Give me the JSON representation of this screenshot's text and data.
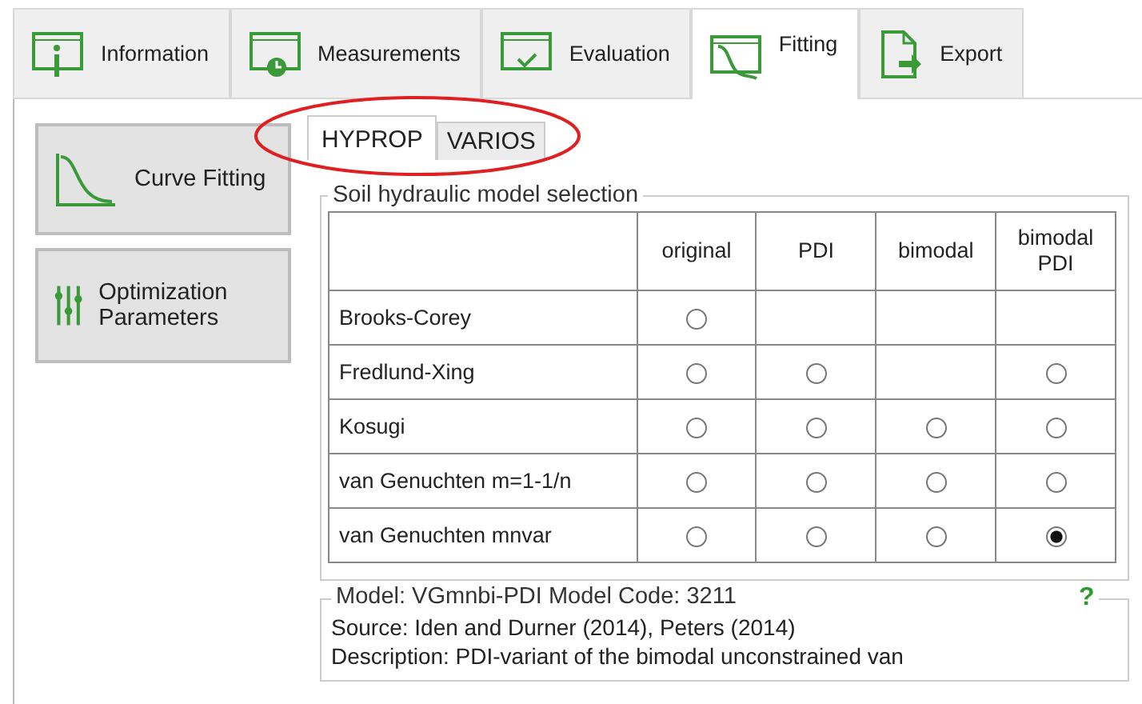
{
  "tabs": [
    {
      "label": "Information",
      "selected": false
    },
    {
      "label": "Measurements",
      "selected": false
    },
    {
      "label": "Evaluation",
      "selected": false
    },
    {
      "label": "Fitting",
      "selected": true
    },
    {
      "label": "Export",
      "selected": false
    }
  ],
  "side_buttons": [
    {
      "label": "Curve Fitting"
    },
    {
      "label": "Optimization Parameters"
    }
  ],
  "sub_tabs": [
    {
      "label": "HYPROP",
      "selected": true
    },
    {
      "label": "VARIOS",
      "selected": false
    }
  ],
  "model_selection": {
    "title": "Soil hydraulic model selection",
    "columns": [
      "original",
      "PDI",
      "bimodal",
      "bimodal PDI"
    ],
    "rows": [
      {
        "name": "Brooks-Corey",
        "cells": [
          {
            "kind": "radio",
            "selected": false
          },
          {
            "kind": "none"
          },
          {
            "kind": "none"
          },
          {
            "kind": "none"
          }
        ]
      },
      {
        "name": "Fredlund-Xing",
        "cells": [
          {
            "kind": "radio",
            "selected": false
          },
          {
            "kind": "radio",
            "selected": false
          },
          {
            "kind": "none"
          },
          {
            "kind": "radio",
            "selected": false
          }
        ]
      },
      {
        "name": "Kosugi",
        "cells": [
          {
            "kind": "radio",
            "selected": false
          },
          {
            "kind": "radio",
            "selected": false
          },
          {
            "kind": "radio",
            "selected": false
          },
          {
            "kind": "radio",
            "selected": false
          }
        ]
      },
      {
        "name": "van Genuchten m=1-1/n",
        "cells": [
          {
            "kind": "radio",
            "selected": false
          },
          {
            "kind": "radio",
            "selected": false
          },
          {
            "kind": "radio",
            "selected": false
          },
          {
            "kind": "radio",
            "selected": false
          }
        ]
      },
      {
        "name": "van Genuchten mnvar",
        "cells": [
          {
            "kind": "radio",
            "selected": false
          },
          {
            "kind": "radio",
            "selected": false
          },
          {
            "kind": "radio",
            "selected": false
          },
          {
            "kind": "radio",
            "selected": true
          }
        ]
      }
    ]
  },
  "model_info": {
    "title": "Model: VGmnbi-PDI  Model Code: 3211",
    "help": "?",
    "source": "Source: Iden and Durner (2014), Peters (2014)",
    "description": "Description: PDI-variant of the bimodal unconstrained van"
  }
}
